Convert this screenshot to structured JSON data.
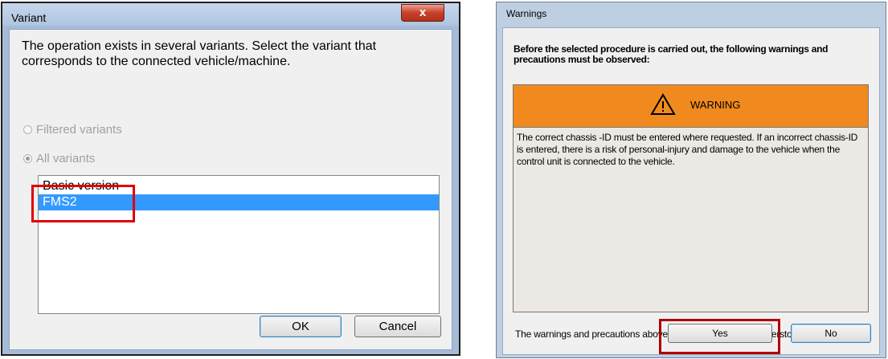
{
  "variant_dialog": {
    "title": "Variant",
    "close_label": "x",
    "message": "The operation exists in several variants. Select the variant that corresponds to the connected vehicle/machine.",
    "radio_filtered": "Filtered variants",
    "radio_all": "All variants",
    "selected_filter": "All variants",
    "variants": [
      "Basic version",
      "FMS2"
    ],
    "selected_variant": "FMS2",
    "ok_label": "OK",
    "cancel_label": "Cancel"
  },
  "warnings_dialog": {
    "title": "Warnings",
    "heading": "Before the selected procedure is carried out, the following warnings and precautions must be observed:",
    "warning_label": "WARNING",
    "warning_text": "The correct chassis -ID must be entered where requested. If an incorrect chassis-ID is entered, there is a risk of personal-injury and damage to the vehicle when the control unit is connected to the vehicle.",
    "footer": "The warnings and precautions above have been read and understood.",
    "yes_label": "Yes",
    "no_label": "No"
  },
  "colors": {
    "selection": "#3399ff",
    "warning_banner": "#f08a1e",
    "highlight_box": "#e00000"
  }
}
